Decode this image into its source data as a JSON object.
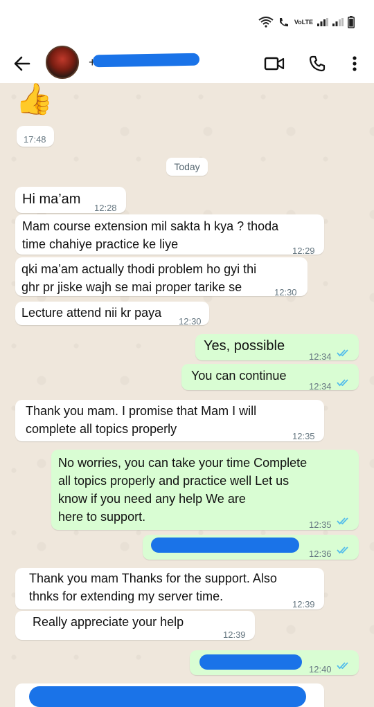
{
  "status_bar": {
    "volte_top": "Vo",
    "volte_bottom": "LTE"
  },
  "header": {
    "contact_prefix": "+",
    "icons": [
      "back-arrow-icon",
      "video-call-icon",
      "phone-icon",
      "more-vert-icon"
    ]
  },
  "date_separator": "Today",
  "messages": [
    {
      "dir": "in",
      "text": "👍",
      "time": "17:48"
    },
    {
      "dir": "in",
      "text": "Hi ma’am",
      "time": "12:28"
    },
    {
      "dir": "in",
      "text": "Mam course extension mil sakta h kya ? thoda\ntime chahiye practice ke liye",
      "time": "12:29"
    },
    {
      "dir": "in",
      "text": "qki ma’am actually thodi problem ho gyi thi\nghr pr jiske wajh se mai proper tarike se",
      "time": "12:30"
    },
    {
      "dir": "in",
      "text": "Lecture attend nii kr paya",
      "time": "12:30"
    },
    {
      "dir": "out",
      "text": "Yes, possible",
      "time": "12:34"
    },
    {
      "dir": "out",
      "text": "You can continue",
      "time": "12:34"
    },
    {
      "dir": "in",
      "text": "Thank you mam. I promise that Mam I will\ncomplete all topics properly",
      "time": "12:35"
    },
    {
      "dir": "out",
      "text": "No worries, you can take your time Complete\nall topics properly and practice well Let us\nknow if you need any help We are\nhere to support.",
      "time": "12:35"
    },
    {
      "dir": "out",
      "text": "",
      "time": "12:36"
    },
    {
      "dir": "in",
      "text": "Thank you mam Thanks for the support. Also\nthnks for extending my server time.",
      "time": "12:39"
    },
    {
      "dir": "in",
      "text": "Really appreciate your help",
      "time": "12:39"
    },
    {
      "dir": "out",
      "text": "",
      "time": "12:40"
    },
    {
      "dir": "in",
      "text": "",
      "time": ""
    }
  ],
  "colors": {
    "incoming": "#ffffff",
    "outgoing": "#d9fdd3",
    "read_ticks": "#53bdeb",
    "redaction": "#1a73e8"
  }
}
